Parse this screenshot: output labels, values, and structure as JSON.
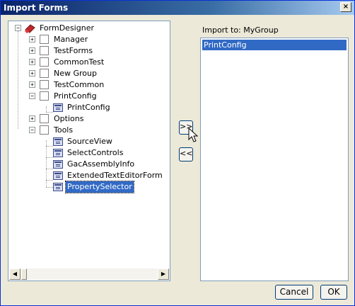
{
  "window": {
    "title": "Import Forms",
    "close_glyph": "×"
  },
  "tree": {
    "root": {
      "label": "FormDesigner",
      "icon": "form-designer-icon"
    },
    "groups": [
      {
        "label": "Manager",
        "expander": "+"
      },
      {
        "label": "TestForms",
        "expander": "+"
      },
      {
        "label": "CommonTest",
        "expander": "+"
      },
      {
        "label": "New Group",
        "expander": "+"
      },
      {
        "label": "TestCommon",
        "expander": "+"
      },
      {
        "label": "PrintConfig",
        "expander": "−",
        "children": [
          "PrintConfig"
        ]
      },
      {
        "label": "Options",
        "expander": "+"
      },
      {
        "label": "Tools",
        "expander": "−",
        "children": [
          "SourceView",
          "SelectControls",
          "GacAssemblyInfo",
          "ExtendedTextEditorForm",
          "PropertySelector"
        ]
      }
    ],
    "selected": "PropertySelector",
    "scroll_left_glyph": "◀",
    "scroll_right_glyph": "▶"
  },
  "import": {
    "label": "Import to: MyGroup",
    "items": [
      "PrintConfig"
    ]
  },
  "buttons": {
    "add": ">>",
    "remove": "<<",
    "cancel": "Cancel",
    "ok": "OK"
  },
  "colors": {
    "selection": "#316ac5",
    "title_start": "#0a246a",
    "dialog_bg": "#ece9d8"
  }
}
